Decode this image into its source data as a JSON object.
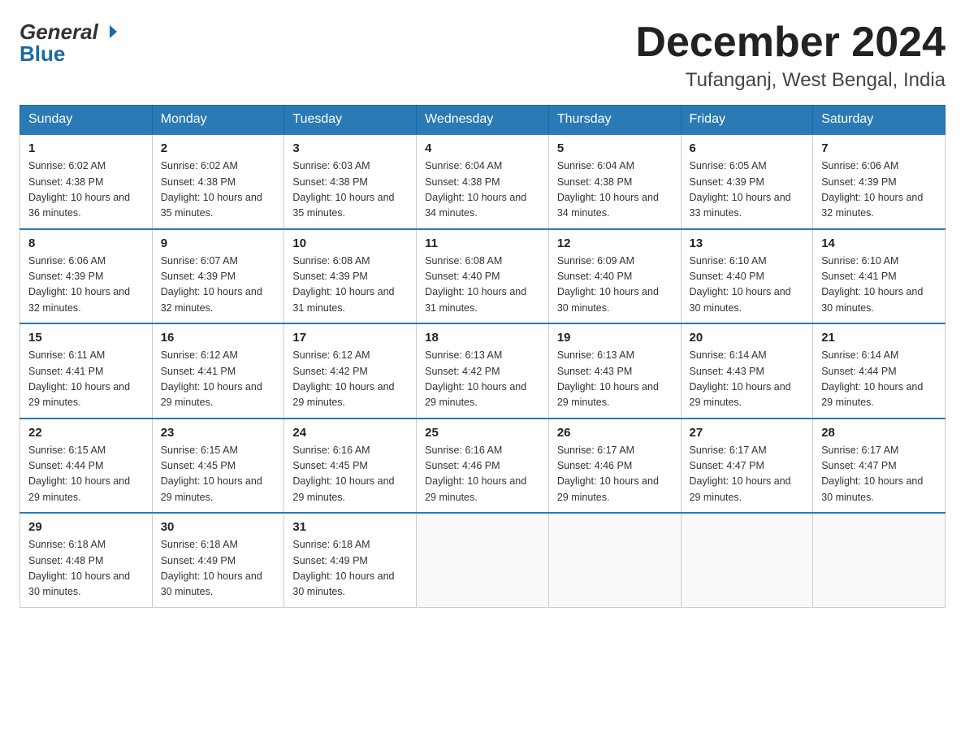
{
  "header": {
    "month_year": "December 2024",
    "location": "Tufanganj, West Bengal, India",
    "logo_text1": "General",
    "logo_text2": "Blue"
  },
  "days_of_week": [
    "Sunday",
    "Monday",
    "Tuesday",
    "Wednesday",
    "Thursday",
    "Friday",
    "Saturday"
  ],
  "weeks": [
    [
      {
        "day": "1",
        "sunrise": "6:02 AM",
        "sunset": "4:38 PM",
        "daylight": "10 hours and 36 minutes."
      },
      {
        "day": "2",
        "sunrise": "6:02 AM",
        "sunset": "4:38 PM",
        "daylight": "10 hours and 35 minutes."
      },
      {
        "day": "3",
        "sunrise": "6:03 AM",
        "sunset": "4:38 PM",
        "daylight": "10 hours and 35 minutes."
      },
      {
        "day": "4",
        "sunrise": "6:04 AM",
        "sunset": "4:38 PM",
        "daylight": "10 hours and 34 minutes."
      },
      {
        "day": "5",
        "sunrise": "6:04 AM",
        "sunset": "4:38 PM",
        "daylight": "10 hours and 34 minutes."
      },
      {
        "day": "6",
        "sunrise": "6:05 AM",
        "sunset": "4:39 PM",
        "daylight": "10 hours and 33 minutes."
      },
      {
        "day": "7",
        "sunrise": "6:06 AM",
        "sunset": "4:39 PM",
        "daylight": "10 hours and 32 minutes."
      }
    ],
    [
      {
        "day": "8",
        "sunrise": "6:06 AM",
        "sunset": "4:39 PM",
        "daylight": "10 hours and 32 minutes."
      },
      {
        "day": "9",
        "sunrise": "6:07 AM",
        "sunset": "4:39 PM",
        "daylight": "10 hours and 32 minutes."
      },
      {
        "day": "10",
        "sunrise": "6:08 AM",
        "sunset": "4:39 PM",
        "daylight": "10 hours and 31 minutes."
      },
      {
        "day": "11",
        "sunrise": "6:08 AM",
        "sunset": "4:40 PM",
        "daylight": "10 hours and 31 minutes."
      },
      {
        "day": "12",
        "sunrise": "6:09 AM",
        "sunset": "4:40 PM",
        "daylight": "10 hours and 30 minutes."
      },
      {
        "day": "13",
        "sunrise": "6:10 AM",
        "sunset": "4:40 PM",
        "daylight": "10 hours and 30 minutes."
      },
      {
        "day": "14",
        "sunrise": "6:10 AM",
        "sunset": "4:41 PM",
        "daylight": "10 hours and 30 minutes."
      }
    ],
    [
      {
        "day": "15",
        "sunrise": "6:11 AM",
        "sunset": "4:41 PM",
        "daylight": "10 hours and 29 minutes."
      },
      {
        "day": "16",
        "sunrise": "6:12 AM",
        "sunset": "4:41 PM",
        "daylight": "10 hours and 29 minutes."
      },
      {
        "day": "17",
        "sunrise": "6:12 AM",
        "sunset": "4:42 PM",
        "daylight": "10 hours and 29 minutes."
      },
      {
        "day": "18",
        "sunrise": "6:13 AM",
        "sunset": "4:42 PM",
        "daylight": "10 hours and 29 minutes."
      },
      {
        "day": "19",
        "sunrise": "6:13 AM",
        "sunset": "4:43 PM",
        "daylight": "10 hours and 29 minutes."
      },
      {
        "day": "20",
        "sunrise": "6:14 AM",
        "sunset": "4:43 PM",
        "daylight": "10 hours and 29 minutes."
      },
      {
        "day": "21",
        "sunrise": "6:14 AM",
        "sunset": "4:44 PM",
        "daylight": "10 hours and 29 minutes."
      }
    ],
    [
      {
        "day": "22",
        "sunrise": "6:15 AM",
        "sunset": "4:44 PM",
        "daylight": "10 hours and 29 minutes."
      },
      {
        "day": "23",
        "sunrise": "6:15 AM",
        "sunset": "4:45 PM",
        "daylight": "10 hours and 29 minutes."
      },
      {
        "day": "24",
        "sunrise": "6:16 AM",
        "sunset": "4:45 PM",
        "daylight": "10 hours and 29 minutes."
      },
      {
        "day": "25",
        "sunrise": "6:16 AM",
        "sunset": "4:46 PM",
        "daylight": "10 hours and 29 minutes."
      },
      {
        "day": "26",
        "sunrise": "6:17 AM",
        "sunset": "4:46 PM",
        "daylight": "10 hours and 29 minutes."
      },
      {
        "day": "27",
        "sunrise": "6:17 AM",
        "sunset": "4:47 PM",
        "daylight": "10 hours and 29 minutes."
      },
      {
        "day": "28",
        "sunrise": "6:17 AM",
        "sunset": "4:47 PM",
        "daylight": "10 hours and 30 minutes."
      }
    ],
    [
      {
        "day": "29",
        "sunrise": "6:18 AM",
        "sunset": "4:48 PM",
        "daylight": "10 hours and 30 minutes."
      },
      {
        "day": "30",
        "sunrise": "6:18 AM",
        "sunset": "4:49 PM",
        "daylight": "10 hours and 30 minutes."
      },
      {
        "day": "31",
        "sunrise": "6:18 AM",
        "sunset": "4:49 PM",
        "daylight": "10 hours and 30 minutes."
      },
      null,
      null,
      null,
      null
    ]
  ]
}
